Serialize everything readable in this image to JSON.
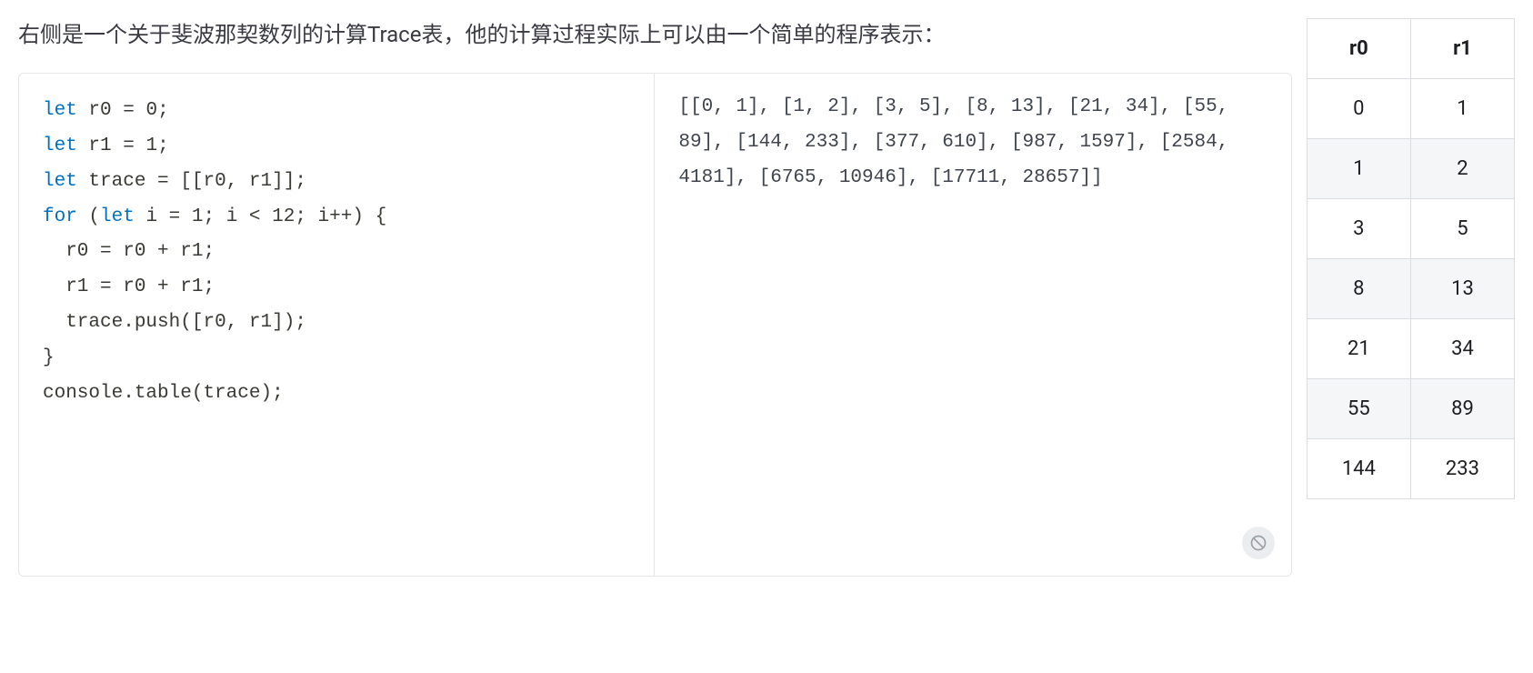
{
  "intro": "右侧是一个关于斐波那契数列的计算Trace表，他的计算过程实际上可以由一个简单的程序表示：",
  "code": {
    "tokens": [
      {
        "t": "let",
        "c": "kw"
      },
      {
        "t": " r0 ",
        "c": ""
      },
      {
        "t": "=",
        "c": "punct"
      },
      {
        "t": " ",
        "c": ""
      },
      {
        "t": "0",
        "c": "punct"
      },
      {
        "t": ";",
        "c": "punct"
      },
      {
        "t": "\n",
        "c": ""
      },
      {
        "t": "let",
        "c": "kw"
      },
      {
        "t": " r1 ",
        "c": ""
      },
      {
        "t": "=",
        "c": "punct"
      },
      {
        "t": " ",
        "c": ""
      },
      {
        "t": "1",
        "c": "punct"
      },
      {
        "t": ";",
        "c": "punct"
      },
      {
        "t": "\n",
        "c": ""
      },
      {
        "t": "let",
        "c": "kw"
      },
      {
        "t": " trace ",
        "c": ""
      },
      {
        "t": "=",
        "c": "punct"
      },
      {
        "t": " ",
        "c": ""
      },
      {
        "t": "[[",
        "c": "punct"
      },
      {
        "t": "r0",
        "c": ""
      },
      {
        "t": ",",
        "c": "punct"
      },
      {
        "t": " r1",
        "c": ""
      },
      {
        "t": "]];",
        "c": "punct"
      },
      {
        "t": "\n",
        "c": ""
      },
      {
        "t": "for",
        "c": "kw"
      },
      {
        "t": " ",
        "c": ""
      },
      {
        "t": "(",
        "c": "punct"
      },
      {
        "t": "let",
        "c": "kw"
      },
      {
        "t": " i ",
        "c": ""
      },
      {
        "t": "=",
        "c": "punct"
      },
      {
        "t": " ",
        "c": ""
      },
      {
        "t": "1",
        "c": "punct"
      },
      {
        "t": ";",
        "c": "punct"
      },
      {
        "t": " i ",
        "c": ""
      },
      {
        "t": "<",
        "c": "punct"
      },
      {
        "t": " ",
        "c": ""
      },
      {
        "t": "12",
        "c": "punct"
      },
      {
        "t": ";",
        "c": "punct"
      },
      {
        "t": " i",
        "c": ""
      },
      {
        "t": "++)",
        "c": "punct"
      },
      {
        "t": " ",
        "c": ""
      },
      {
        "t": "{",
        "c": "punct"
      },
      {
        "t": "\n",
        "c": ""
      },
      {
        "t": "  r0 ",
        "c": ""
      },
      {
        "t": "=",
        "c": "punct"
      },
      {
        "t": " r0 ",
        "c": ""
      },
      {
        "t": "+",
        "c": "punct"
      },
      {
        "t": " r1",
        "c": ""
      },
      {
        "t": ";",
        "c": "punct"
      },
      {
        "t": "\n",
        "c": ""
      },
      {
        "t": "  r1 ",
        "c": ""
      },
      {
        "t": "=",
        "c": "punct"
      },
      {
        "t": " r0 ",
        "c": ""
      },
      {
        "t": "+",
        "c": "punct"
      },
      {
        "t": " r1",
        "c": ""
      },
      {
        "t": ";",
        "c": "punct"
      },
      {
        "t": "\n",
        "c": ""
      },
      {
        "t": "  trace",
        "c": ""
      },
      {
        "t": ".",
        "c": "punct"
      },
      {
        "t": "push",
        "c": ""
      },
      {
        "t": "([",
        "c": "punct"
      },
      {
        "t": "r0",
        "c": ""
      },
      {
        "t": ",",
        "c": "punct"
      },
      {
        "t": " r1",
        "c": ""
      },
      {
        "t": "]);",
        "c": "punct"
      },
      {
        "t": "\n",
        "c": ""
      },
      {
        "t": "}",
        "c": "punct"
      },
      {
        "t": "\n",
        "c": ""
      },
      {
        "t": "console",
        "c": ""
      },
      {
        "t": ".",
        "c": "punct"
      },
      {
        "t": "table",
        "c": ""
      },
      {
        "t": "(",
        "c": "punct"
      },
      {
        "t": "trace",
        "c": ""
      },
      {
        "t": ");",
        "c": "punct"
      }
    ]
  },
  "output": "[[0, 1], [1, 2], [3, 5], [8, 13], [21, 34], [55, 89], [144, 233], [377, 610], [987, 1597], [2584, 4181], [6765, 10946], [17711, 28657]]",
  "table": {
    "headers": [
      "r0",
      "r1"
    ],
    "rows": [
      [
        "0",
        "1"
      ],
      [
        "1",
        "2"
      ],
      [
        "3",
        "5"
      ],
      [
        "8",
        "13"
      ],
      [
        "21",
        "34"
      ],
      [
        "55",
        "89"
      ],
      [
        "144",
        "233"
      ]
    ]
  }
}
